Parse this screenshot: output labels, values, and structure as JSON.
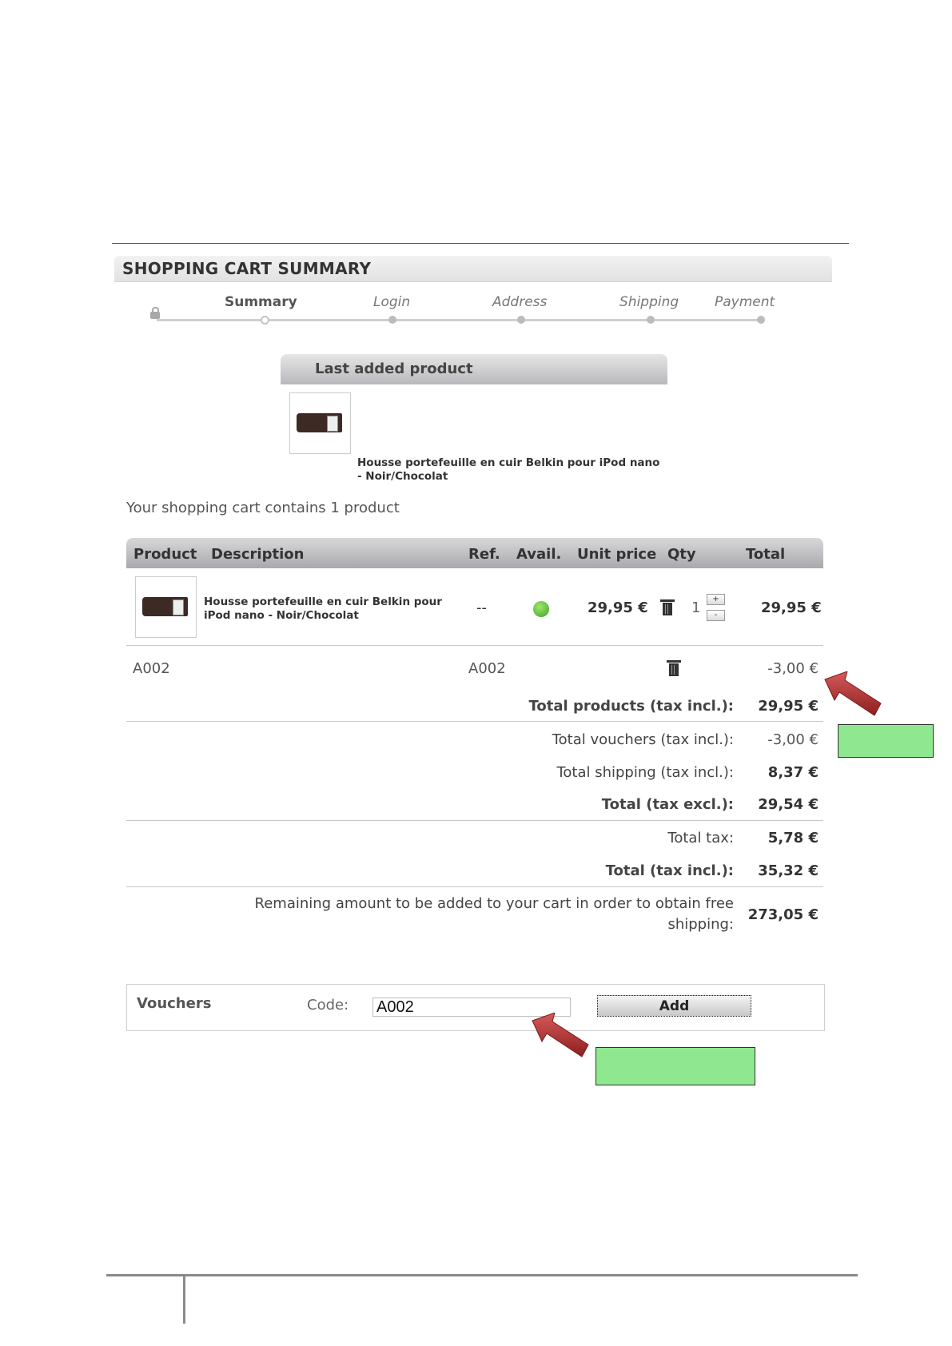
{
  "header": {
    "title": "SHOPPING CART SUMMARY"
  },
  "steps": [
    "Summary",
    "Login",
    "Address",
    "Shipping",
    "Payment"
  ],
  "last_added": {
    "title": "Last added product",
    "product_name": "Housse portefeuille en cuir Belkin pour iPod nano - Noir/Chocolat"
  },
  "cart_count": "Your shopping cart contains 1 product",
  "table": {
    "headers": {
      "product": "Product",
      "description": "Description",
      "ref": "Ref.",
      "avail": "Avail.",
      "unit_price": "Unit price",
      "qty": "Qty",
      "total": "Total"
    },
    "item": {
      "description": "Housse portefeuille en cuir Belkin pour iPod nano - Noir/Chocolat",
      "ref": "--",
      "unit_price": "29,95 €",
      "qty": "1",
      "total": "29,95 €",
      "qty_plus": "+",
      "qty_minus": "-"
    },
    "voucher_row": {
      "name": "A002",
      "ref": "A002",
      "total": "-3,00 €"
    }
  },
  "totals": [
    {
      "label": "Total products (tax incl.):",
      "value": "29,95 €",
      "bold": true
    },
    {
      "label": "Total vouchers (tax incl.):",
      "value": "-3,00 €",
      "bold": false
    },
    {
      "label": "Total shipping (tax incl.):",
      "value": "8,37 €",
      "bold": false
    },
    {
      "label": "Total (tax excl.):",
      "value": "29,54 €",
      "bold": true
    },
    {
      "label": "Total tax:",
      "value": "5,78 €",
      "bold": false
    },
    {
      "label": "Total (tax incl.):",
      "value": "35,32 €",
      "bold": true
    }
  ],
  "remaining": {
    "line1": "Remaining amount to be added to your cart in order to obtain free",
    "line2": "shipping:",
    "value": "273,05 €"
  },
  "vouchers": {
    "title": "Vouchers",
    "code_label": "Code:",
    "code_value": "A002",
    "add_label": "Add"
  },
  "colors": {
    "callout_arrow": "#b83232",
    "highlight_box": "#8fe88f",
    "avail_green": "#4cb033"
  }
}
